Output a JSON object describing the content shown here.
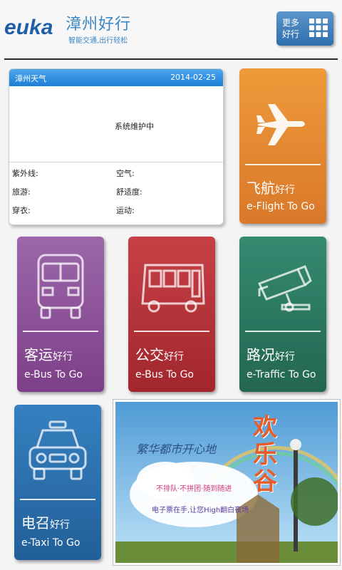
{
  "header": {
    "logo_text": "euka",
    "title": "漳州好行",
    "subtitle": "智能交通,出行轻松",
    "more_button": {
      "line1": "更多",
      "line2": "好行"
    }
  },
  "weather": {
    "title": "漳州天气",
    "date": "2014-02-25",
    "message": "系统维护中",
    "uv_label": "紫外线:",
    "air_label": "空气:",
    "travel_label": "旅游:",
    "comfort_label": "舒适度:",
    "dress_label": "穿衣:",
    "sport_label": "运动:"
  },
  "tiles": {
    "flight": {
      "zh": "飞航",
      "zh_suffix": "好行",
      "en": "e-Flight To Go",
      "icon": "airplane-icon",
      "color": "#e58a2e"
    },
    "coach": {
      "zh": "客运",
      "zh_suffix": "好行",
      "en": "e-Bus To Go",
      "icon": "coach-bus-icon",
      "color": "#8a4e96"
    },
    "bus": {
      "zh": "公交",
      "zh_suffix": "好行",
      "en": "e-Bus To Go",
      "icon": "city-bus-icon",
      "color": "#b53238"
    },
    "traffic": {
      "zh": "路况",
      "zh_suffix": "好行",
      "en": "e-Traffic To Go",
      "icon": "camera-icon",
      "color": "#2c7a63"
    },
    "taxi": {
      "zh": "电召",
      "zh_suffix": "好行",
      "en": "e-Taxi To Go",
      "icon": "taxi-icon",
      "color": "#2b6aa6"
    }
  },
  "banner": {
    "title": "繁华都市开心地",
    "big_text": "欢乐谷",
    "line1": "不排队·不拼团·随到随进",
    "line2": "电子票在手,让您High翻白夜场"
  }
}
